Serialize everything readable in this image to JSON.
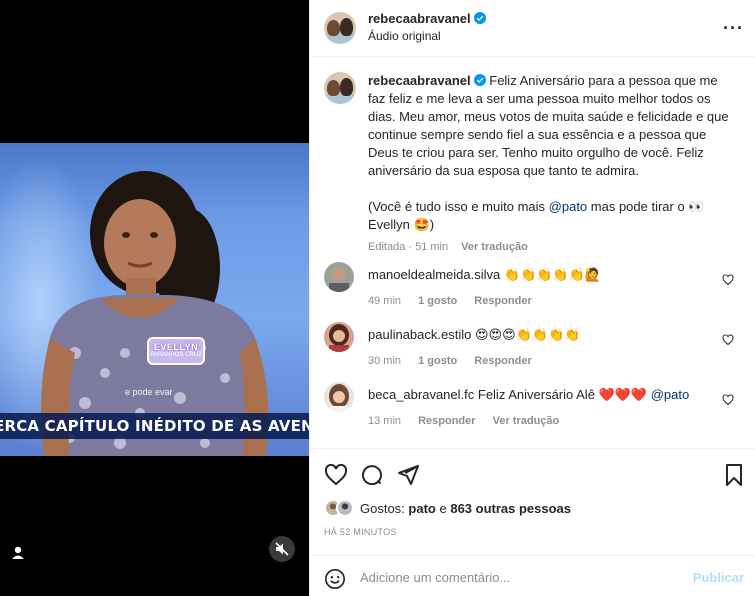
{
  "video": {
    "caption_text": "ERCA CAPÍTULO INÉDITO DE AS AVENTURAS",
    "subtitle": "e pode evar",
    "name_tag": "EVELLYN",
    "name_tag_sub": "PARANHOS CRUZ"
  },
  "header": {
    "username": "rebecaabravanel",
    "subtitle": "Áudio original"
  },
  "caption": {
    "username": "rebecaabravanel",
    "text1": "Feliz Aniversário para a pessoa que me faz feliz e me leva a ser uma pessoa muito melhor todos os dias. Meu amor, meus votos de muita saúde e felicidade e que continue sempre sendo fiel a sua essência e a pessoa que Deus te criou para ser. Tenho muito orgulho de você. Feliz aniversário da sua esposa que tanto te admira.",
    "text2_pre": "(Você é tudo isso e muito mais ",
    "mention": "@pato",
    "text2_post": " mas pode tirar o 👀 Evellyn 🤩)",
    "edited": "Editada · 51 min",
    "translate": "Ver tradução"
  },
  "comments": [
    {
      "username": "manoeldealmeida.silva",
      "text": "👏👏👏👏👏🙋",
      "time": "49 min",
      "likes": "1 gosto",
      "reply": "Responder"
    },
    {
      "username": "paulinaback.estilo",
      "text": "😍😍😍👏👏👏👏",
      "time": "30 min",
      "likes": "1 gosto",
      "reply": "Responder"
    },
    {
      "username": "beca_abravanel.fc",
      "text_pre": "Feliz Aniversário Alê ❤️❤️❤️ ",
      "mention": "@pato",
      "time": "13 min",
      "reply": "Responder",
      "translate": "Ver tradução"
    }
  ],
  "likes": {
    "prefix": "Gostos: ",
    "user": "pato",
    "mid": " e ",
    "others": "863 outras pessoas"
  },
  "time_ago": "HÁ 52 MINUTOS",
  "add_comment": {
    "placeholder": "Adicione um comentário...",
    "post_label": "Publicar"
  }
}
